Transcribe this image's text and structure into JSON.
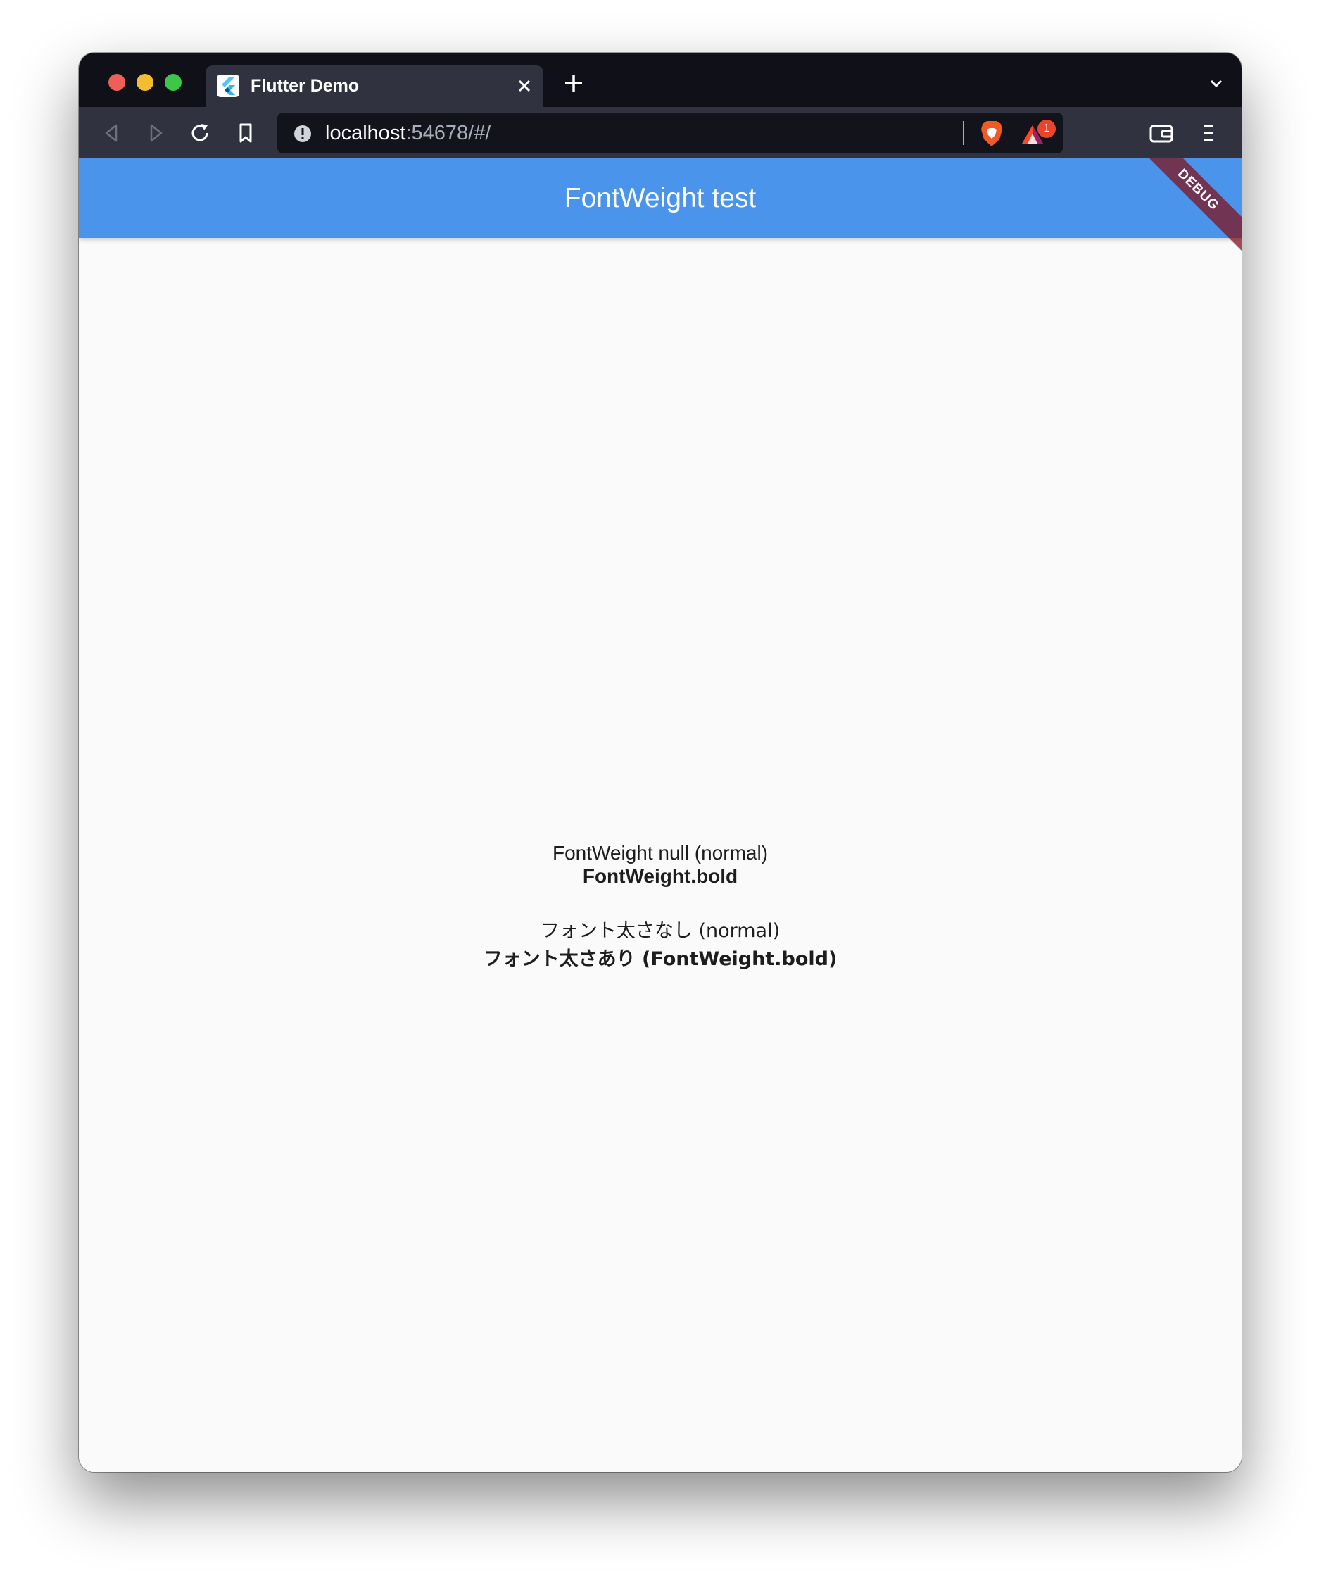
{
  "browser": {
    "tab": {
      "title": "Flutter Demo"
    },
    "url": {
      "host": "localhost",
      "rest": ":54678/#/"
    },
    "rewards_badge": "1"
  },
  "app": {
    "title": "FontWeight test",
    "debug_label": "DEBUG",
    "lines": {
      "normal_en": "FontWeight null (normal)",
      "bold_en": "FontWeight.bold",
      "normal_jp": "フォント太さなし (normal)",
      "bold_jp": "フォント太さあり (FontWeight.bold)"
    }
  },
  "colors": {
    "appbar": "#4a94ec",
    "tabstrip": "#0f1018",
    "toolbar": "#30333f",
    "debug_banner": "#801420"
  }
}
